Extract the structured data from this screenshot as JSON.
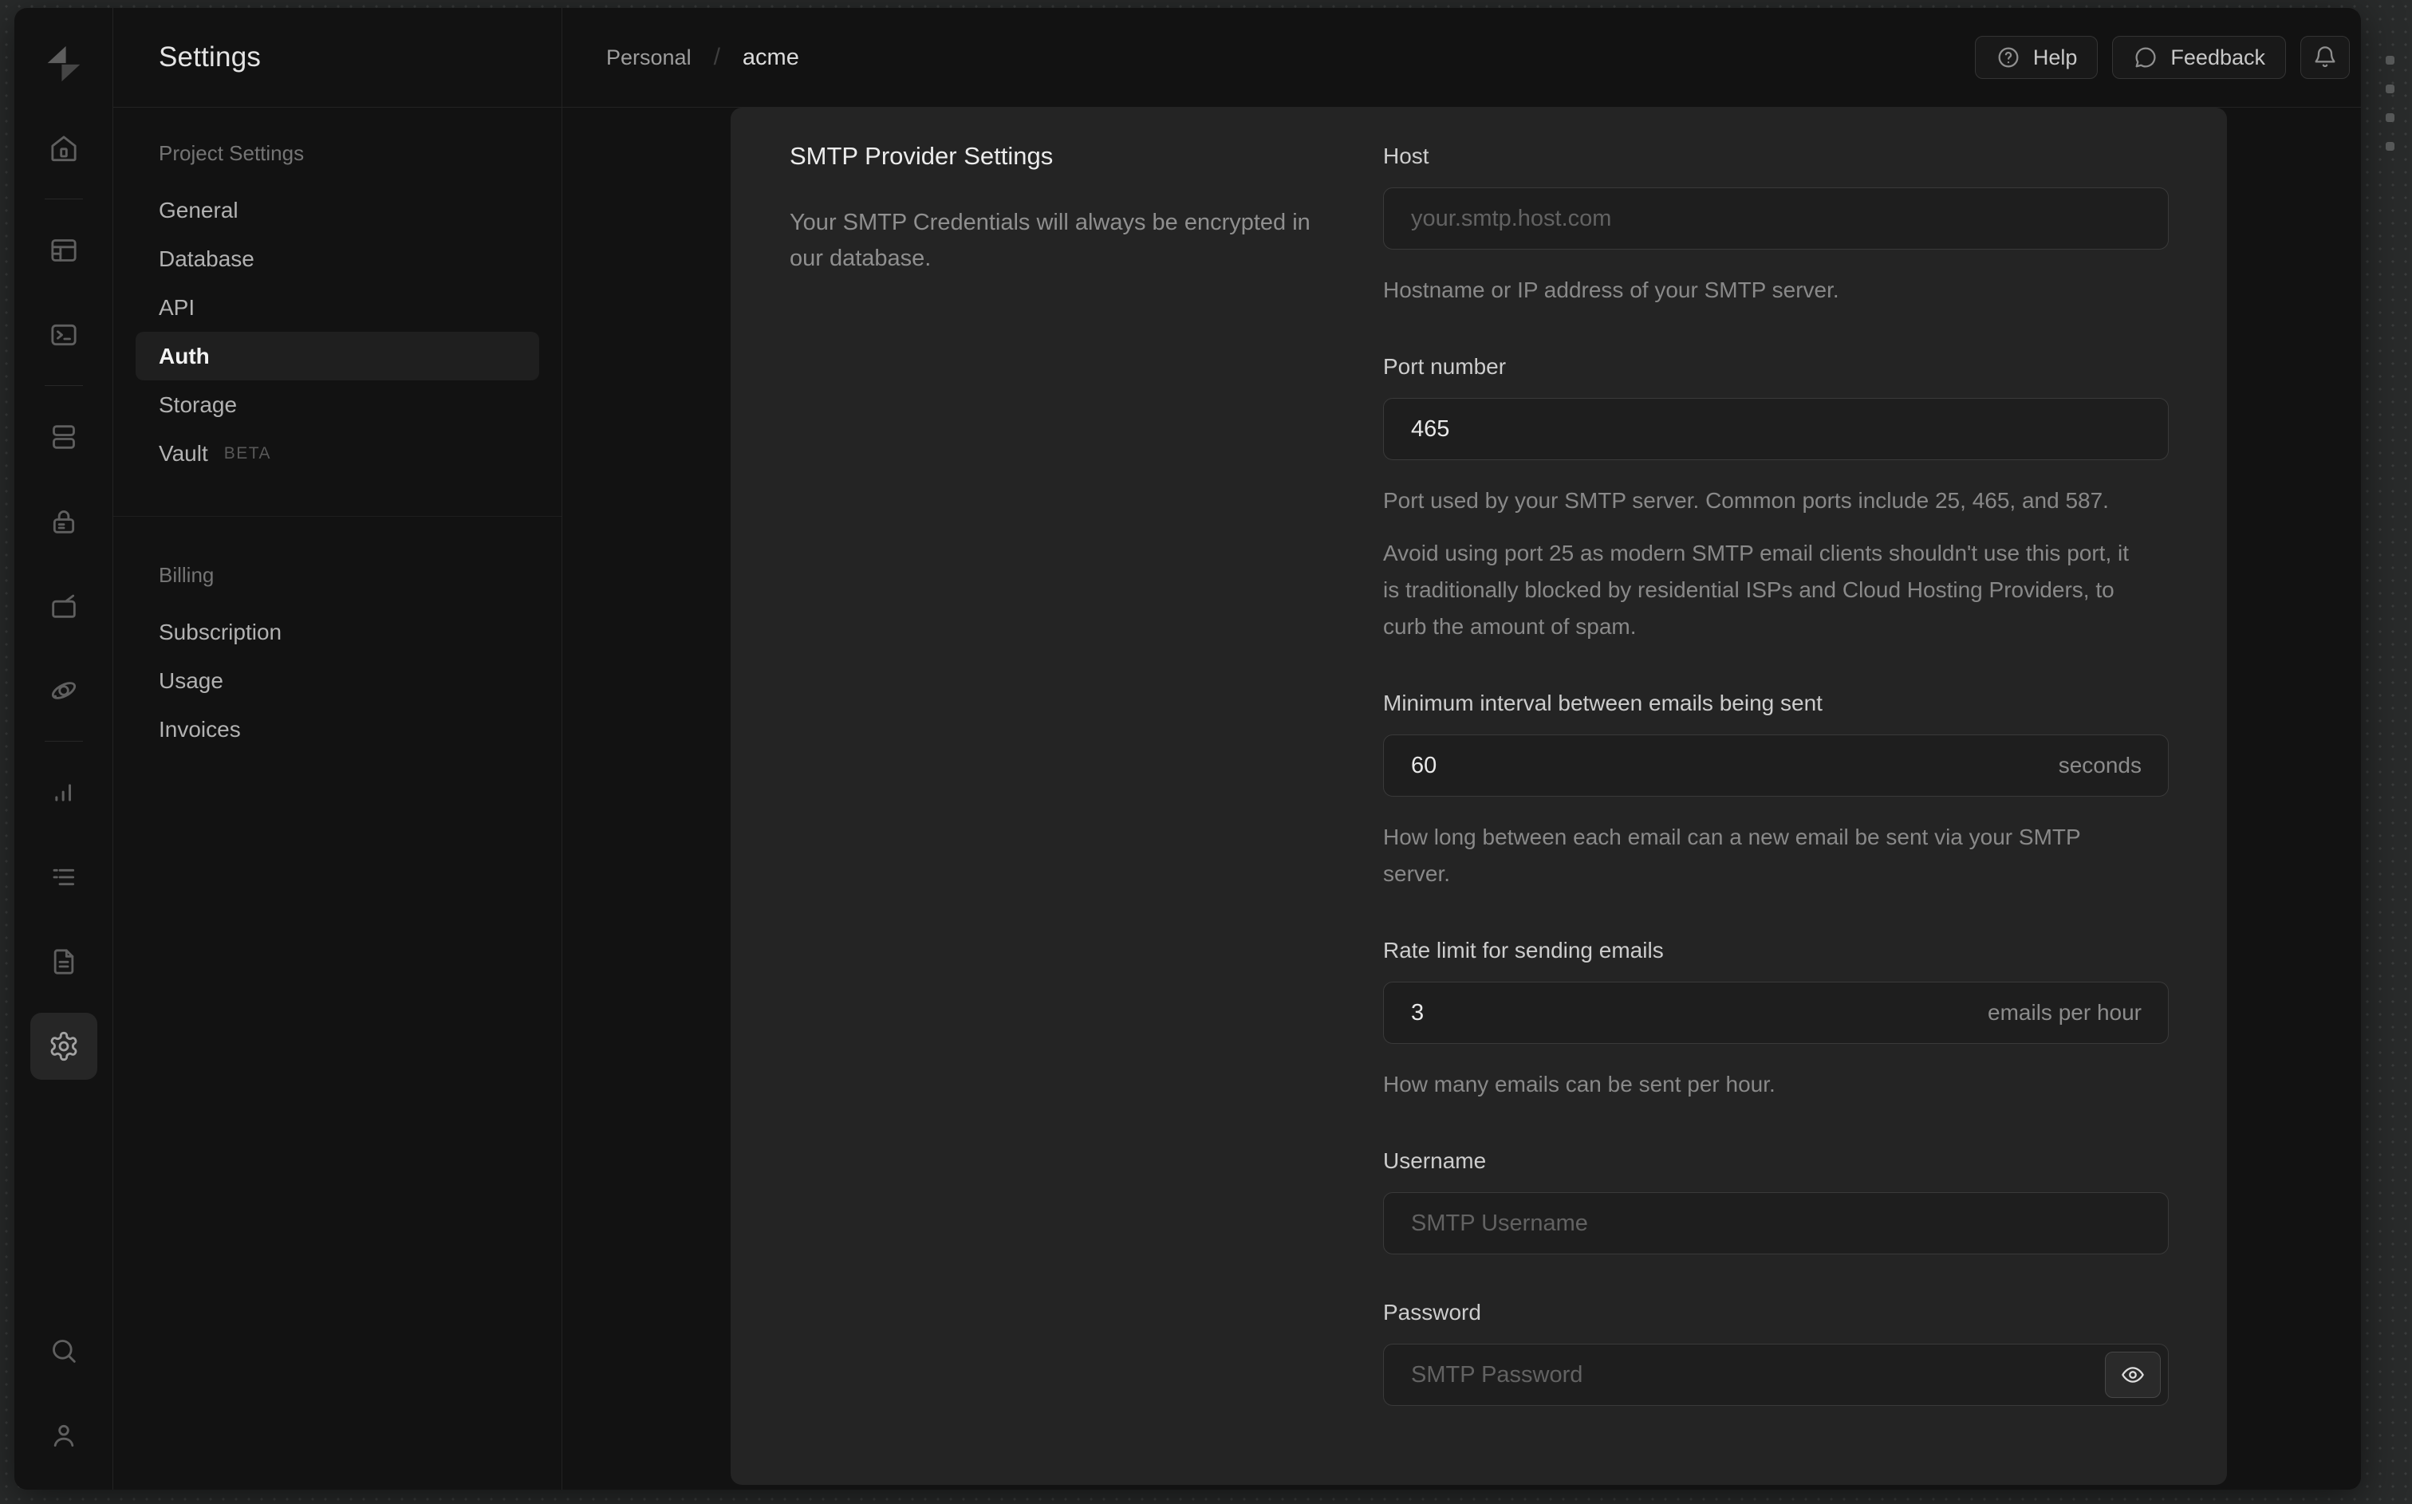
{
  "app": {
    "nav_title": "Settings",
    "breadcrumb": {
      "org": "Personal",
      "separator": "/",
      "project": "acme"
    },
    "topbar": {
      "help_label": "Help",
      "feedback_label": "Feedback"
    }
  },
  "nav": {
    "sections": [
      {
        "header": "Project Settings",
        "items": [
          {
            "label": "General"
          },
          {
            "label": "Database"
          },
          {
            "label": "API"
          },
          {
            "label": "Auth",
            "active": true
          },
          {
            "label": "Storage"
          },
          {
            "label": "Vault",
            "badge": "BETA"
          }
        ]
      },
      {
        "header": "Billing",
        "items": [
          {
            "label": "Subscription"
          },
          {
            "label": "Usage"
          },
          {
            "label": "Invoices"
          }
        ]
      }
    ]
  },
  "smtp": {
    "section_title": "SMTP Provider Settings",
    "section_description": "Your SMTP Credentials will always be encrypted in our database.",
    "host": {
      "label": "Host",
      "placeholder": "your.smtp.host.com",
      "help": "Hostname or IP address of your SMTP server."
    },
    "port": {
      "label": "Port number",
      "value": "465",
      "help": "Port used by your SMTP server. Common ports include 25, 465, and 587.",
      "note": "Avoid using port 25 as modern SMTP email clients shouldn't use this port, it is traditionally blocked by residential ISPs and Cloud Hosting Providers, to curb the amount of spam."
    },
    "interval": {
      "label": "Minimum interval between emails being sent",
      "value": "60",
      "suffix": "seconds",
      "help": "How long between each email can a new email be sent via your SMTP server."
    },
    "rate": {
      "label": "Rate limit for sending emails",
      "value": "3",
      "suffix": "emails per hour",
      "help": "How many emails can be sent per hour."
    },
    "username": {
      "label": "Username",
      "placeholder": "SMTP Username"
    },
    "password": {
      "label": "Password",
      "placeholder": "SMTP Password"
    }
  },
  "icons": [
    "supabase-logo",
    "home",
    "table-editor",
    "sql-editor",
    "database",
    "authentication",
    "storage",
    "edge-functions",
    "reports",
    "logs",
    "docs",
    "project-settings",
    "search",
    "account",
    "help-circle",
    "feedback-bubble",
    "bell",
    "eye"
  ],
  "colors": {
    "desktop_bg": "#292b2b",
    "window_bg": "#121212",
    "panel_bg": "#242424",
    "input_bg": "#1e1e1e",
    "border": "#232323",
    "input_border": "#3a3a3a",
    "heading_text": "#ececec",
    "muted_text": "#898989",
    "nav_active_bg": "#1f1f1f"
  }
}
